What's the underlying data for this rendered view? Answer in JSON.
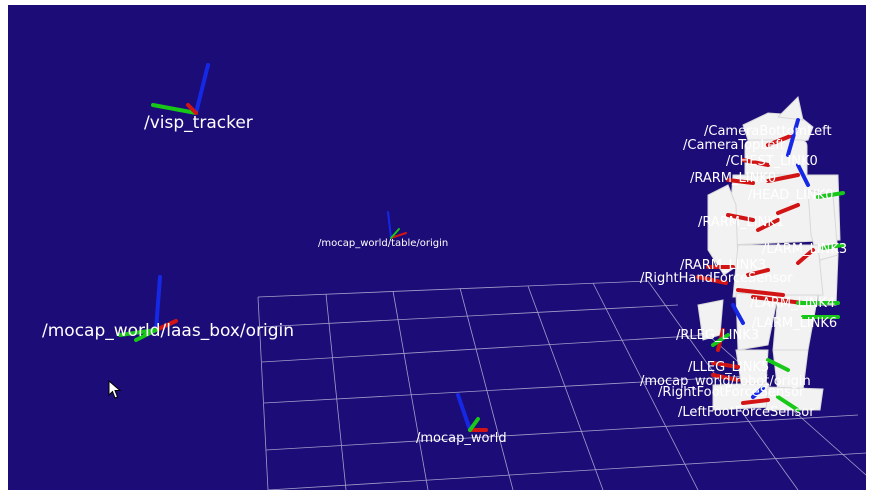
{
  "window": {
    "background": "#1c0c78",
    "grid_color": "#b8b8d8"
  },
  "frames": {
    "visp_tracker": "/visp_tracker",
    "table_origin": "/mocap_world/table/origin",
    "laas_box_origin": "/mocap_world/laas_box/origin",
    "mocap_world": "/mocap_world"
  },
  "robot_labels": [
    "/CameraBottomLeft",
    "/CameraTopLeft",
    "/CHEST_LINK0",
    "/RARM_LINK0",
    "/HEAD_LINK0",
    "/RARM_LINK1",
    "/LARM_LINK3",
    "/RARM_LINK3",
    "/RightHandForceSensor",
    "/LARM_LINK4",
    "/LARM_LINK6",
    "/RLEG_LINK3",
    "/LLEG_LINK5",
    "/mocap_world/robot/origin",
    "/RightFootForceSensor",
    "/LeftFootForceSensor"
  ],
  "axis_colors": {
    "x": "#d21414",
    "y": "#18c818",
    "z": "#1428e6"
  },
  "icons": {
    "pointer": "mouse-pointer-icon"
  }
}
